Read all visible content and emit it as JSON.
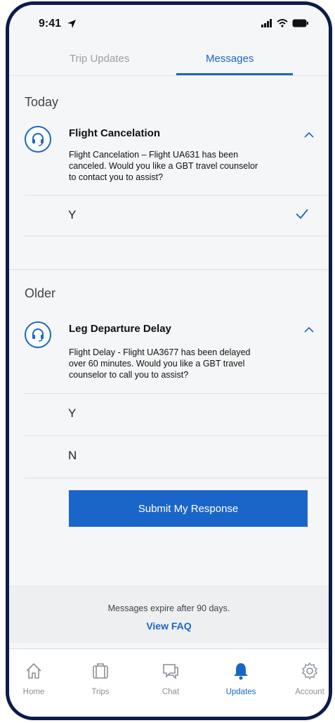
{
  "status_bar": {
    "time": "9:41"
  },
  "tabs": [
    {
      "label": "Trip Updates",
      "active": false
    },
    {
      "label": "Messages",
      "active": true
    }
  ],
  "sections": [
    {
      "title": "Today",
      "message": {
        "title": "Flight Cancelation",
        "body": "Flight Cancelation – Flight UA631 has been canceled. Would you like a GBT travel counselor to contact you to assist?",
        "options": [
          {
            "label": "Y",
            "selected": true
          }
        ]
      }
    },
    {
      "title": "Older",
      "message": {
        "title": "Leg Departure Delay",
        "body": "Flight Delay - Flight UA3677 has been delayed over 60 minutes. Would you like a GBT travel counselor to call you to assist?",
        "options": [
          {
            "label": "Y",
            "selected": false
          },
          {
            "label": "N",
            "selected": false
          }
        ],
        "submit_label": "Submit My Response"
      }
    }
  ],
  "footer": {
    "note": "Messages expire after 90 days.",
    "faq_link": "View FAQ"
  },
  "bottom_nav": [
    {
      "label": "Home",
      "icon": "home-icon",
      "active": false
    },
    {
      "label": "Trips",
      "icon": "suitcase-icon",
      "active": false
    },
    {
      "label": "Chat",
      "icon": "chat-icon",
      "active": false
    },
    {
      "label": "Updates",
      "icon": "bell-icon",
      "active": true
    },
    {
      "label": "Account",
      "icon": "gear-icon",
      "active": false
    }
  ],
  "colors": {
    "accent": "#1a66c8",
    "frame": "#0d1b4a",
    "background": "#f5f6f7"
  }
}
